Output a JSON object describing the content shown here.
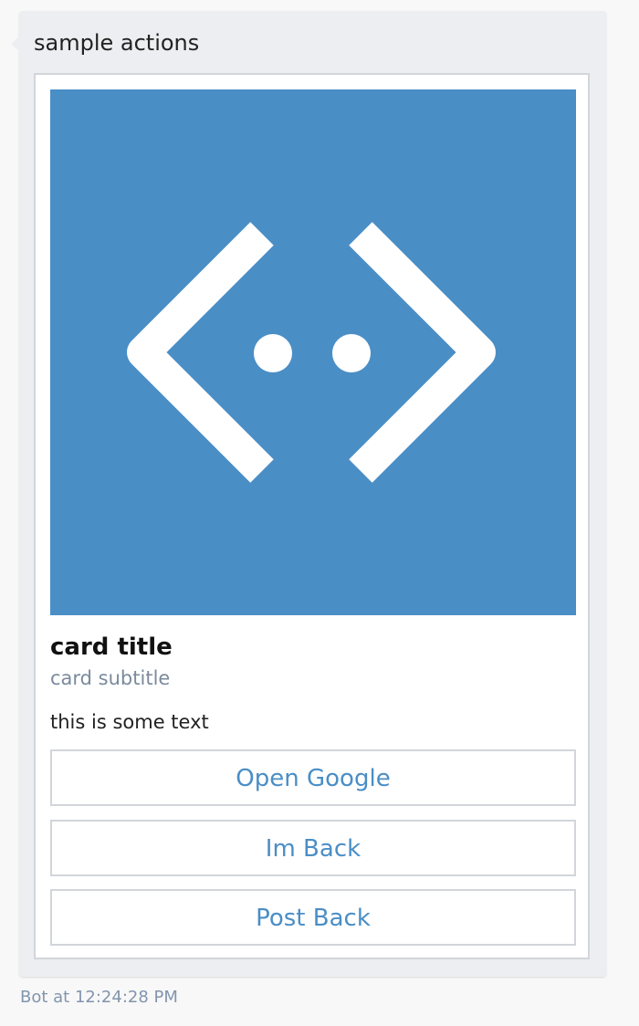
{
  "message": {
    "text": "sample actions",
    "sender": "Bot",
    "time": "12:24:28 PM",
    "timestamp_label": "Bot at 12:24:28 PM"
  },
  "card": {
    "image_icon": "bot-framework-logo-icon",
    "image_bg_color": "#4a8ec6",
    "title": "card title",
    "subtitle": "card subtitle",
    "text": "this is some text",
    "buttons": [
      {
        "label": "Open Google"
      },
      {
        "label": "Im Back"
      },
      {
        "label": "Post Back"
      }
    ]
  },
  "colors": {
    "bubble_bg": "#eceef1",
    "card_border": "#d2d5da",
    "accent": "#4a8ec6",
    "subtitle": "#7b8a9c",
    "timestamp": "#8295ad"
  }
}
